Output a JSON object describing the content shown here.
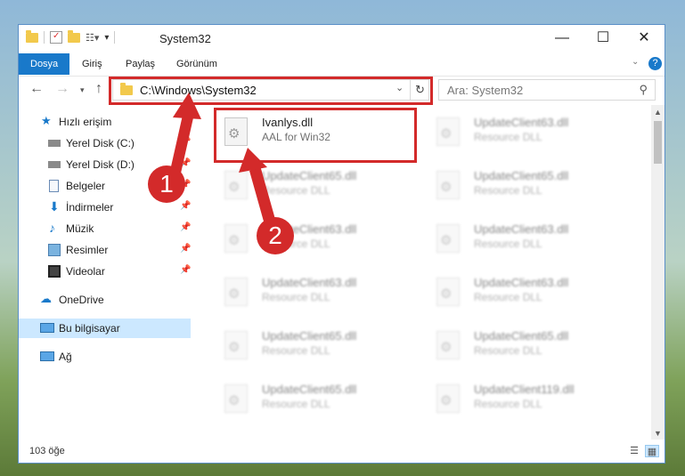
{
  "window": {
    "title": "System32"
  },
  "ribbon": {
    "tabs": [
      "Dosya",
      "Giriş",
      "Paylaş",
      "Görünüm"
    ]
  },
  "address": {
    "path": "C:\\Windows\\System32"
  },
  "search": {
    "placeholder": "Ara: System32"
  },
  "sidebar": {
    "items": [
      {
        "label": "Hızlı erişim",
        "icon": "star-icon",
        "pinned": false
      },
      {
        "label": "Yerel Disk (C:)",
        "icon": "drive-icon",
        "pinned": true
      },
      {
        "label": "Yerel Disk (D:)",
        "icon": "drive-icon",
        "pinned": true
      },
      {
        "label": "Belgeler",
        "icon": "documents-icon",
        "pinned": true
      },
      {
        "label": "İndirmeler",
        "icon": "download-icon",
        "pinned": true
      },
      {
        "label": "Müzik",
        "icon": "music-icon",
        "pinned": true
      },
      {
        "label": "Resimler",
        "icon": "pictures-icon",
        "pinned": true
      },
      {
        "label": "Videolar",
        "icon": "videos-icon",
        "pinned": true
      },
      {
        "label": "OneDrive",
        "icon": "onedrive-icon",
        "pinned": false
      },
      {
        "label": "Bu bilgisayar",
        "icon": "computer-icon",
        "pinned": false
      },
      {
        "label": "Ağ",
        "icon": "network-icon",
        "pinned": false
      }
    ]
  },
  "files": [
    {
      "name": "Ivanlys.dll",
      "desc": "AAL for Win32"
    },
    {
      "name": "UpdateClient63.dll",
      "desc": "Resource DLL"
    },
    {
      "name": "UpdateClient65.dll",
      "desc": "Resource DLL"
    },
    {
      "name": "UpdateClient65.dll",
      "desc": "Resource DLL"
    },
    {
      "name": "UpdateClient63.dll",
      "desc": "Resource DLL"
    },
    {
      "name": "UpdateClient63.dll",
      "desc": "Resource DLL"
    },
    {
      "name": "UpdateClient63.dll",
      "desc": "Resource DLL"
    },
    {
      "name": "UpdateClient63.dll",
      "desc": "Resource DLL"
    },
    {
      "name": "UpdateClient65.dll",
      "desc": "Resource DLL"
    },
    {
      "name": "UpdateClient65.dll",
      "desc": "Resource DLL"
    },
    {
      "name": "UpdateClient65.dll",
      "desc": "Resource DLL"
    },
    {
      "name": "UpdateClient119.dll",
      "desc": "Resource DLL"
    }
  ],
  "status": {
    "count": "103 öğe"
  },
  "callouts": [
    "1",
    "2"
  ],
  "colors": {
    "accent": "#1979ca",
    "highlight": "#d32a2a",
    "selected": "#cce8ff"
  }
}
